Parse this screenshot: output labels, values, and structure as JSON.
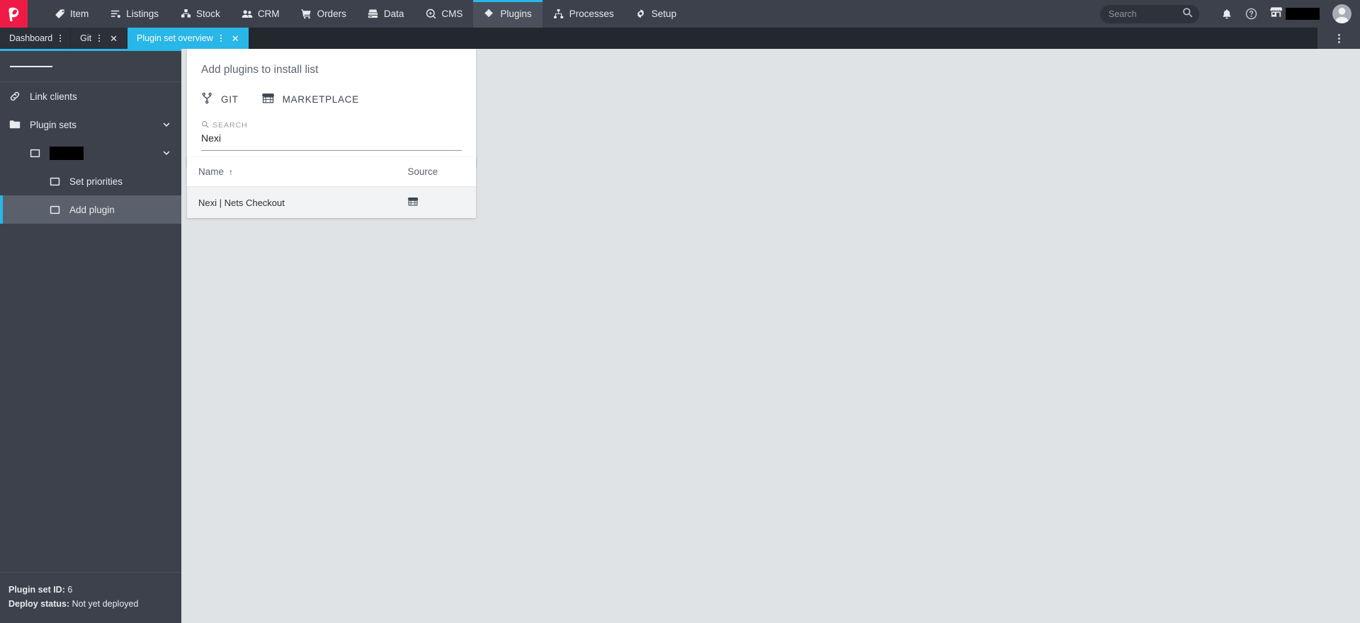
{
  "topnav": {
    "logo_alt": "plenty-logo",
    "items": [
      {
        "label": "Item",
        "icon": "tag-icon",
        "active": false
      },
      {
        "label": "Listings",
        "icon": "list-icon",
        "active": false
      },
      {
        "label": "Stock",
        "icon": "boxes-icon",
        "active": false
      },
      {
        "label": "CRM",
        "icon": "people-icon",
        "active": false
      },
      {
        "label": "Orders",
        "icon": "cart-icon",
        "active": false
      },
      {
        "label": "Data",
        "icon": "database-icon",
        "active": false
      },
      {
        "label": "CMS",
        "icon": "cms-icon",
        "active": false
      },
      {
        "label": "Plugins",
        "icon": "puzzle-icon",
        "active": true
      },
      {
        "label": "Processes",
        "icon": "sitemap-icon",
        "active": false
      },
      {
        "label": "Setup",
        "icon": "gear-icon",
        "active": false
      }
    ],
    "search_placeholder": "Search",
    "icons": {
      "search": "search-icon",
      "notifications": "bell-icon",
      "help": "help-icon",
      "shop": "shop-icon"
    },
    "shop_name_redacted": "",
    "avatar": "user-avatar"
  },
  "tabs": {
    "items": [
      {
        "label": "Dashboard",
        "active": false,
        "closable": false
      },
      {
        "label": "Git",
        "active": false,
        "closable": true
      },
      {
        "label": "Plugin set overview",
        "active": true,
        "closable": true
      }
    ],
    "overflow_menu": "tabbar-overflow-menu"
  },
  "sidebar": {
    "menu_toggle": "hamburger-icon",
    "items": [
      {
        "label": "Link clients",
        "icon": "link-icon",
        "level": 0,
        "expandable": false,
        "active": false
      },
      {
        "label": "Plugin sets",
        "icon": "folder-icon",
        "level": 0,
        "expandable": true,
        "active": false
      },
      {
        "label": "",
        "icon": "plugin-set-icon",
        "level": 1,
        "expandable": true,
        "active": false,
        "redacted": true
      },
      {
        "label": "Set priorities",
        "icon": "plugin-set-icon",
        "level": 2,
        "expandable": false,
        "active": false
      },
      {
        "label": "Add plugin",
        "icon": "plugin-set-icon",
        "level": 2,
        "expandable": false,
        "active": true
      }
    ],
    "footer": {
      "plugin_set_id_label": "Plugin set ID:",
      "plugin_set_id_value": "6",
      "deploy_status_label": "Deploy status:",
      "deploy_status_value": "Not yet deployed"
    }
  },
  "panel": {
    "title": "Add plugins to install list",
    "sources": [
      {
        "label": "GIT",
        "icon": "git-branch-icon"
      },
      {
        "label": "MARKETPLACE",
        "icon": "marketplace-icon"
      }
    ],
    "search_label": "SEARCH",
    "search_value": "Nexi",
    "search_placeholder": ""
  },
  "results": {
    "columns": [
      {
        "key": "name",
        "label": "Name",
        "sorted": true,
        "sort_dir": "asc",
        "sort_glyph": "↑"
      },
      {
        "key": "source",
        "label": "Source",
        "sorted": false
      }
    ],
    "rows": [
      {
        "name": "Nexi | Nets Checkout",
        "source_icon": "marketplace-icon"
      }
    ]
  },
  "colors": {
    "brand_red": "#ed1b45",
    "accent_cyan": "#29b6e8",
    "topbar_bg": "#3c414c",
    "tabbar_bg": "#23272e",
    "sidebar_bg": "#3c414c",
    "content_bg": "#dfe3e6",
    "panel_bg": "#ffffff",
    "row_bg": "#f1f3f5"
  }
}
